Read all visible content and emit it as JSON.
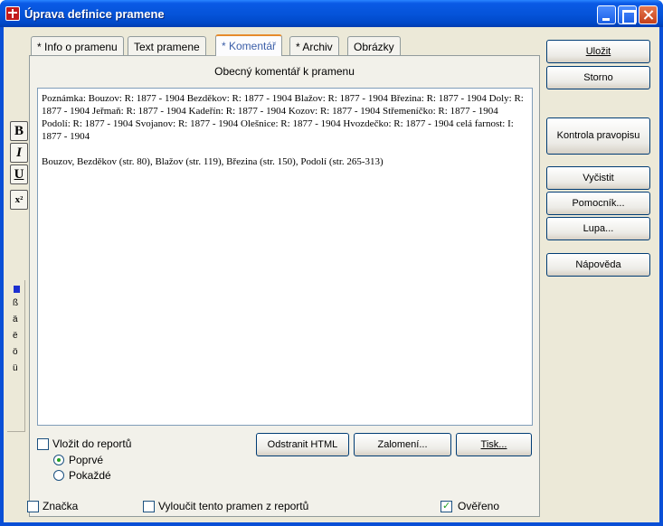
{
  "window": {
    "title": "Úprava definice pramene"
  },
  "tabs": [
    {
      "label": "* Info o pramenu"
    },
    {
      "label": "Text pramene"
    },
    {
      "label": "* Komentář",
      "active": true
    },
    {
      "label": "* Archiv"
    },
    {
      "label": "Obrázky"
    }
  ],
  "panel": {
    "heading": "Obecný komentář k pramenu"
  },
  "editor": {
    "paragraphs": [
      "Poznámka: Bouzov: R: 1877 - 1904 Bezděkov: R: 1877 - 1904 Blažov: R: 1877 - 1904 Březina: R: 1877 - 1904 Doly: R: 1877 - 1904 Jeřmaň: R: 1877 - 1904 Kadeřín: R: 1877 - 1904 Kozov: R: 1877 - 1904 Střemeníčko: R: 1877 - 1904 Podolí: R: 1877 - 1904 Svojanov: R: 1877 - 1904 Olešnice: R: 1877 - 1904 Hvozdečko: R: 1877 - 1904 celá farnost: I: 1877 - 1904",
      "Bouzov, Bezděkov (str. 80), Blažov (str. 119), Březina (str. 150), Podolí (str. 265-313)"
    ]
  },
  "formatting": {
    "bold": "B",
    "italic": "I",
    "underline": "U",
    "superscript": "x²"
  },
  "special_chars": [
    "ß",
    "ä",
    "ë",
    "ö",
    "ü"
  ],
  "options": {
    "insert_to_reports": "Vložit do reportů",
    "radio_first": "Poprvé",
    "radio_every": "Pokaždé",
    "radio_selected": "Poprvé"
  },
  "panel_buttons": {
    "remove_html": "Odstranit HTML",
    "wrap": "Zalomení...",
    "print": "Tisk..."
  },
  "side_buttons": {
    "save": "Uložit",
    "cancel": "Storno",
    "spellcheck": "Kontrola pravopisu",
    "clear": "Vyčistit",
    "helper": "Pomocník...",
    "magnifier": "Lupa...",
    "help": "Nápověda"
  },
  "footer": {
    "mark": "Značka",
    "exclude": "Vyloučit tento pramen z reportů",
    "verified": "Ověřeno",
    "verified_checked": true
  }
}
